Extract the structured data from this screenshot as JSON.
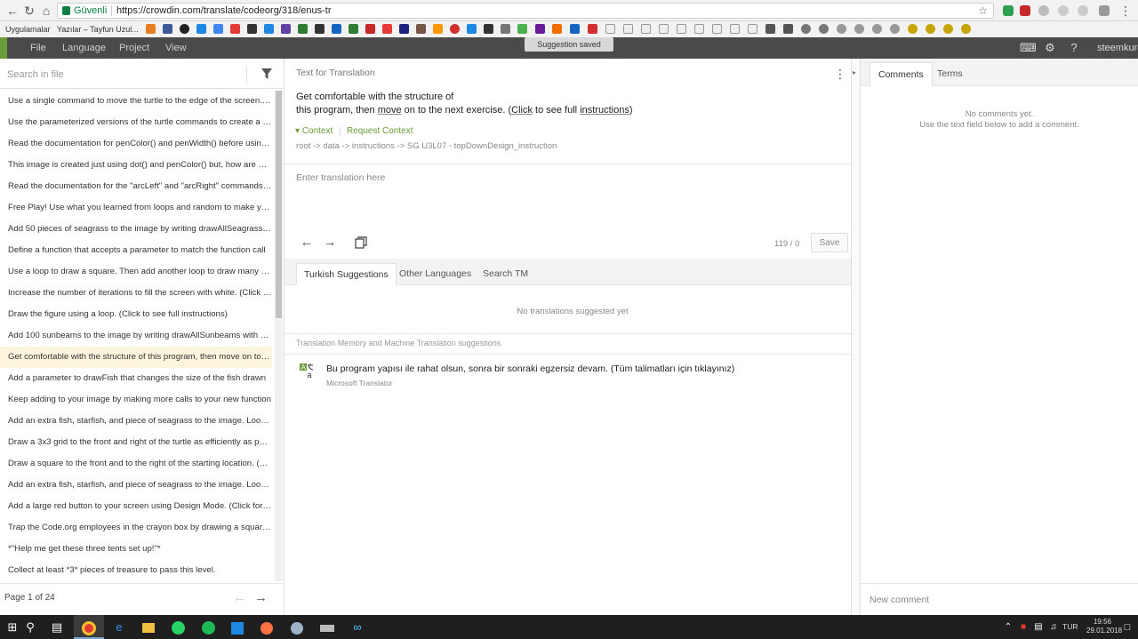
{
  "browser": {
    "secure_label": "Güvenli",
    "url": "https://crowdin.com/translate/codeorg/318/enus-tr",
    "bookmarks_apps_label": "Uygulamalar",
    "bookmark_first": "Yazılar – Tayfun Uzul..."
  },
  "toast": {
    "text": "Suggestion saved"
  },
  "menu": {
    "file": "File",
    "language": "Language",
    "project": "Project",
    "view": "View",
    "user": "steemkurd"
  },
  "left": {
    "search_placeholder": "Search in file",
    "strings": [
      "Use a single command to move the turtle to the edge of the screen. (Click to see full instructions)",
      "Use the parameterized versions of the turtle commands to create a design",
      "Read the documentation for penColor() and penWidth() before using them",
      "This image is created just using dot() and penColor() but, how are we going to",
      "Read the documentation for the \"arcLeft\" and \"arcRight\" commands before",
      "Free Play! Use what you learned from loops and random to make your own",
      "Add 50 pieces of seagrass to the image by writing drawAllSeagrass with a loop",
      "Define a function that accepts a parameter to match the function call",
      "Use a loop to draw a square. Then add another loop to draw many squares",
      "Increase the number of iterations to fill the screen with white. (Click to see",
      "Draw the figure using a loop. (Click to see full instructions)",
      "Add 100 sunbeams to the image by writing drawAllSunbeams with a loop",
      "Get comfortable with the structure of this program, then move on to the next",
      "Add a parameter to drawFish that changes the size of the fish drawn",
      "Keep adding to your image by making more calls to your new function",
      "Add an extra fish, starfish, and piece of seagrass to the image. Look at",
      "Draw a 3x3 grid to the front and right of the turtle as efficiently as possible",
      "Draw a square to the front and to the right of the starting location. (Click",
      "Add an extra fish, starfish, and piece of seagrass to the image. Look at the",
      "Add a large red button to your screen using Design Mode. (Click for full",
      "Trap the Code.org employees in the crayon box by drawing a square around",
      "*\"Help me get these three tents set up!\"*",
      "Collect at least *3* pieces of treasure to pass this level."
    ],
    "active_index": 12,
    "pager_label": "Page 1 of 24"
  },
  "editor": {
    "header_label": "Text for Translation",
    "source_line1": "Get comfortable with the structure of",
    "source_line2_a": "this program, then ",
    "source_line2_b": "move",
    "source_line2_c": " on to the next exercise. (",
    "source_line2_d": "Click",
    "source_line2_e": " to see full ",
    "source_line2_f": "instructions",
    "source_line2_g": ")",
    "context_label": "Context",
    "request_context_label": "Request Context",
    "breadcrumb": "root -> data -> instructions -> SG U3L07 - topDownDesign_instruction",
    "translation_placeholder": "Enter translation here",
    "counter": "119 / 0",
    "save_label": "Save"
  },
  "suggestions": {
    "tabs": [
      "Turkish Suggestions",
      "Other Languages",
      "Search TM"
    ],
    "active_tab": 0,
    "empty_text": "No translations suggested yet",
    "tm_section_label": "Translation Memory and Machine Translation suggestions",
    "mt_text": "Bu program yapısı ile rahat olsun, sonra bir sonraki egzersiz devam. (Tüm talimatları için tıklayınız)",
    "mt_source": "Microsoft Translator"
  },
  "comments": {
    "tabs": [
      "Comments",
      "Terms"
    ],
    "active_tab": 0,
    "empty_line1": "No comments yet.",
    "empty_line2": "Use the text field below to add a comment.",
    "input_placeholder": "New comment"
  },
  "taskbar": {
    "lang": "TUR",
    "time": "19:56",
    "date": "29.01.2018"
  },
  "colors": {
    "accent_green": "#6a9c3a",
    "appbar_bg": "#4a4a4a",
    "active_row": "#fdf5dd"
  }
}
